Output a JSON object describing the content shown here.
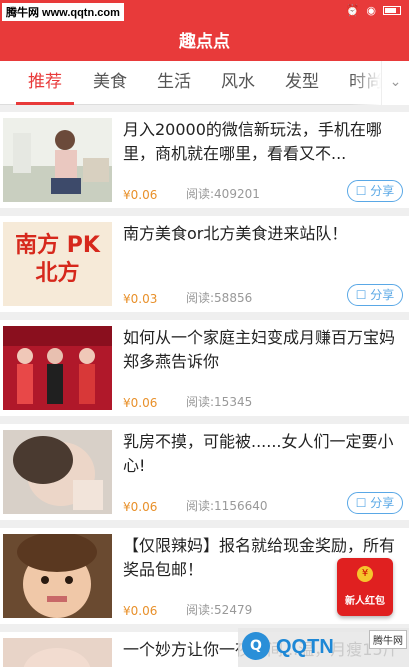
{
  "watermark_top": "腾牛网 www.qqtn.com",
  "status": {
    "right_icons": [
      "alarm-icon",
      "wifi-icon",
      "battery-icon"
    ]
  },
  "header": {
    "title": "趣点点"
  },
  "tabs": [
    {
      "label": "推荐",
      "active": true
    },
    {
      "label": "美食"
    },
    {
      "label": "生活"
    },
    {
      "label": "风水"
    },
    {
      "label": "发型"
    },
    {
      "label": "时尚"
    }
  ],
  "share_label": "分享",
  "articles": [
    {
      "title": "月入20000的微信新玩法，手机在哪里，商机就在哪里，看看又不...",
      "price": "¥0.06",
      "reads": "阅读:409201",
      "thumb_text": ""
    },
    {
      "title": "南方美食or北方美食进来站队！",
      "price": "¥0.03",
      "reads": "阅读:58856",
      "thumb_text": "南方 PK 北方"
    },
    {
      "title": "如何从一个家庭主妇变成月赚百万宝妈郑多燕告诉你",
      "price": "¥0.06",
      "reads": "阅读:15345",
      "thumb_text": ""
    },
    {
      "title": "乳房不摸，可能被......女人们一定要小心!",
      "price": "¥0.06",
      "reads": "阅读:1156640",
      "thumb_text": ""
    },
    {
      "title": "【仅限辣妈】报名就给现金奖励，所有奖品包邮！",
      "price": "¥0.06",
      "reads": "阅读:52479",
      "thumb_text": ""
    },
    {
      "title": "一个妙方让你一夜之间...温，月瘦15斤",
      "price": "",
      "reads": "",
      "thumb_text": ""
    }
  ],
  "red_packet": {
    "label": "新人红包"
  },
  "bottom_watermark": {
    "brand": "QQTN",
    "badge": "腾牛网"
  }
}
